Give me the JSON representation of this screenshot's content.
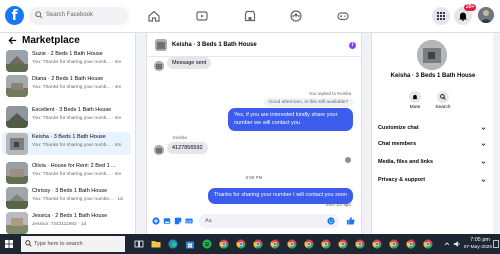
{
  "topbar": {
    "logo": "f",
    "search_placeholder": "Search Facebook",
    "notification_count": "20+"
  },
  "sidebar": {
    "title": "Marketplace",
    "items": [
      {
        "title": "Suzie · 2 Beds 1 Bath House",
        "subtitle": "You: Thanks for sharing your numb... · 4m"
      },
      {
        "title": "Diana · 2 Beds 1 Bath House",
        "subtitle": "You: Thanks for sharing your numb... · 4m"
      },
      {
        "title": "Excellent · 3 Beds 1 Bath House",
        "subtitle": "You: Thanks for sharing your numb... · 4m"
      },
      {
        "title": "Keisha · 3 Beds 1 Bath House",
        "subtitle": "You: Thanks for sharing your numb... · 4m",
        "active": true
      },
      {
        "title": "Olivia · House for Rent: 2 Bed 1 ...",
        "subtitle": "You: Thanks for sharing your numb... · 4m"
      },
      {
        "title": "Chrissy · 3 Beds 1 Bath House",
        "subtitle": "You: Thanks for sharing your numbe... · 1d"
      },
      {
        "title": "Jessica · 2 Beds 1 Bath House",
        "subtitle": "Jessica: 7243111982 · 1d"
      }
    ]
  },
  "chat": {
    "title": "Keisha · 3 Beds 1 Bath House",
    "info_icon": "i",
    "msg_partial": "Message sent",
    "replied_label": "You replied to Keisha",
    "quoted_text": "Good afternoon, is this still available?",
    "out_msg_1": "Yes, if you are interested kindly share your number we will contact you",
    "sender_name": "Keisha",
    "in_msg": "4127856592",
    "timestamp": "6:59 PM",
    "out_msg_2": "Thanks for sharing your number I will contact you soon",
    "sent_label": "Sent 1m ago",
    "compose_placeholder": "Aa"
  },
  "details": {
    "title": "Keisha · 3 Beds 1 Bath House",
    "mute_label": "Mute",
    "search_label": "Search",
    "sections": [
      "Customize chat",
      "Chat members",
      "Media, files and links",
      "Privacy & support"
    ]
  },
  "taskbar": {
    "search_placeholder": "Type here to search",
    "time": "7:05 pm",
    "date": "07-May-2025"
  },
  "colors": {
    "brand": "#1877f2",
    "outgoing_bubble": "#3b5ced",
    "active_item": "#e7f3ff",
    "taskbar": "#1c2733"
  }
}
